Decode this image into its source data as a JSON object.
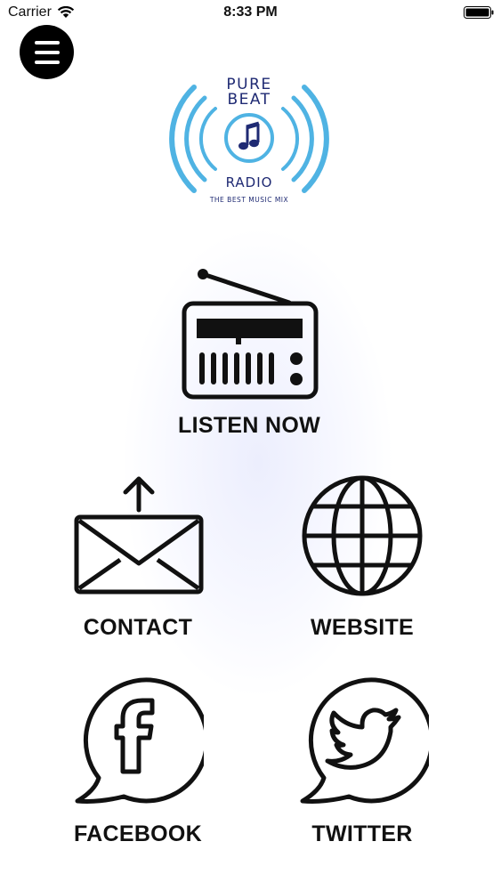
{
  "status_bar": {
    "carrier": "Carrier",
    "time": "8:33 PM"
  },
  "logo": {
    "line1": "PURE",
    "line2": "BEAT",
    "line3": "RADIO",
    "tagline": "THE BEST MUSIC MIX"
  },
  "menu": [
    {
      "label": "LISTEN NOW",
      "icon": "radio-icon"
    },
    {
      "label": "CONTACT",
      "icon": "mail-upload-icon"
    },
    {
      "label": "WEBSITE",
      "icon": "globe-icon"
    },
    {
      "label": "FACEBOOK",
      "icon": "facebook-bubble-icon"
    },
    {
      "label": "TWITTER",
      "icon": "twitter-bubble-icon"
    }
  ],
  "colors": {
    "brand_blue": "#4fb3e3",
    "brand_navy": "#1f2a73",
    "icon_black": "#111111"
  }
}
